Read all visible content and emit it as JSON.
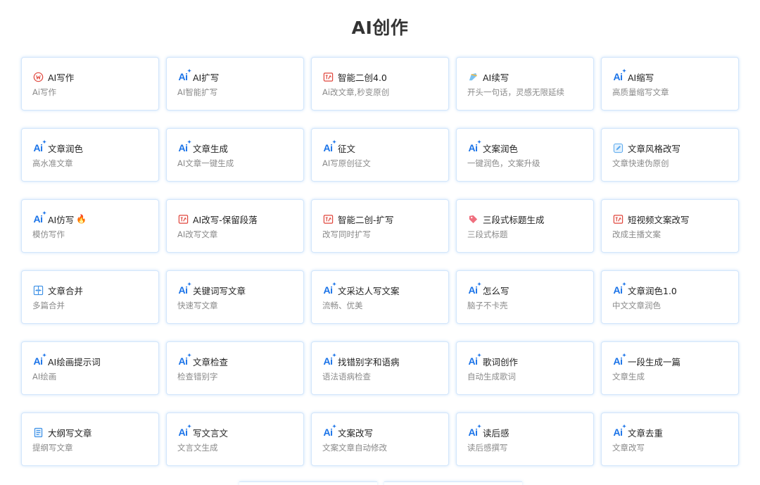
{
  "title": "AI创作",
  "colors": {
    "accent": "#1a73e8",
    "red_icon": "#e0463c",
    "card_border": "#d3e6fb"
  },
  "cards": [
    {
      "title": "AI写作",
      "desc": "Ai写作",
      "icon": "ai-write-circle-icon"
    },
    {
      "title": "AI扩写",
      "desc": "AI智能扩写",
      "icon": "ai-logo-icon"
    },
    {
      "title": "智能二创4.0",
      "desc": "Ai改文章,秒变原创",
      "icon": "rewrite-square-icon"
    },
    {
      "title": "AI续写",
      "desc": "开头一句话，灵感无限延续",
      "icon": "quill-pen-icon"
    },
    {
      "title": "AI缩写",
      "desc": "高质量缩写文章",
      "icon": "ai-logo-icon"
    },
    {
      "title": "文章润色",
      "desc": "高水准文章",
      "icon": "ai-logo-icon"
    },
    {
      "title": "文章生成",
      "desc": "AI文章一键生成",
      "icon": "ai-logo-icon"
    },
    {
      "title": "征文",
      "desc": "AI写原创征文",
      "icon": "ai-logo-icon"
    },
    {
      "title": "文案润色",
      "desc": "一键润色，文案升级",
      "icon": "ai-logo-icon"
    },
    {
      "title": "文章风格改写",
      "desc": "文章快速伪原创",
      "icon": "edit-square-icon"
    },
    {
      "title": "AI仿写",
      "desc": "模仿写作",
      "icon": "ai-logo-icon",
      "hot": true
    },
    {
      "title": "AI改写-保留段落",
      "desc": "AI改写文章",
      "icon": "rewrite-square-icon"
    },
    {
      "title": "智能二创-扩写",
      "desc": "改写同时扩写",
      "icon": "rewrite-square-icon"
    },
    {
      "title": "三段式标题生成",
      "desc": "三段式标题",
      "icon": "tag-icon"
    },
    {
      "title": "短视频文案改写",
      "desc": "改成主播文案",
      "icon": "rewrite-square-icon"
    },
    {
      "title": "文章合并",
      "desc": "多篇合并",
      "icon": "merge-icon"
    },
    {
      "title": "关键词写文章",
      "desc": "快速写文章",
      "icon": "ai-logo-icon"
    },
    {
      "title": "文采达人写文案",
      "desc": "流畅、优美",
      "icon": "ai-logo-icon"
    },
    {
      "title": "怎么写",
      "desc": "脑子不卡壳",
      "icon": "ai-logo-icon"
    },
    {
      "title": "文章润色1.0",
      "desc": "中文文章润色",
      "icon": "ai-logo-icon"
    },
    {
      "title": "AI绘画提示词",
      "desc": "AI绘画",
      "icon": "ai-logo-icon"
    },
    {
      "title": "文章检查",
      "desc": "检查错别字",
      "icon": "ai-logo-icon"
    },
    {
      "title": "找错别字和语病",
      "desc": "语法语病检查",
      "icon": "ai-logo-icon"
    },
    {
      "title": "歌词创作",
      "desc": "自动生成歌词",
      "icon": "ai-logo-icon"
    },
    {
      "title": "一段生成一篇",
      "desc": "文章生成",
      "icon": "ai-logo-icon"
    },
    {
      "title": "大纲写文章",
      "desc": "提纲写文章",
      "icon": "document-icon"
    },
    {
      "title": "写文言文",
      "desc": "文言文生成",
      "icon": "ai-logo-icon"
    },
    {
      "title": "文案改写",
      "desc": "文案文章自动修改",
      "icon": "ai-logo-icon"
    },
    {
      "title": "读后感",
      "desc": "读后感撰写",
      "icon": "ai-logo-icon"
    },
    {
      "title": "文章去重",
      "desc": "文章改写",
      "icon": "ai-logo-icon"
    }
  ]
}
